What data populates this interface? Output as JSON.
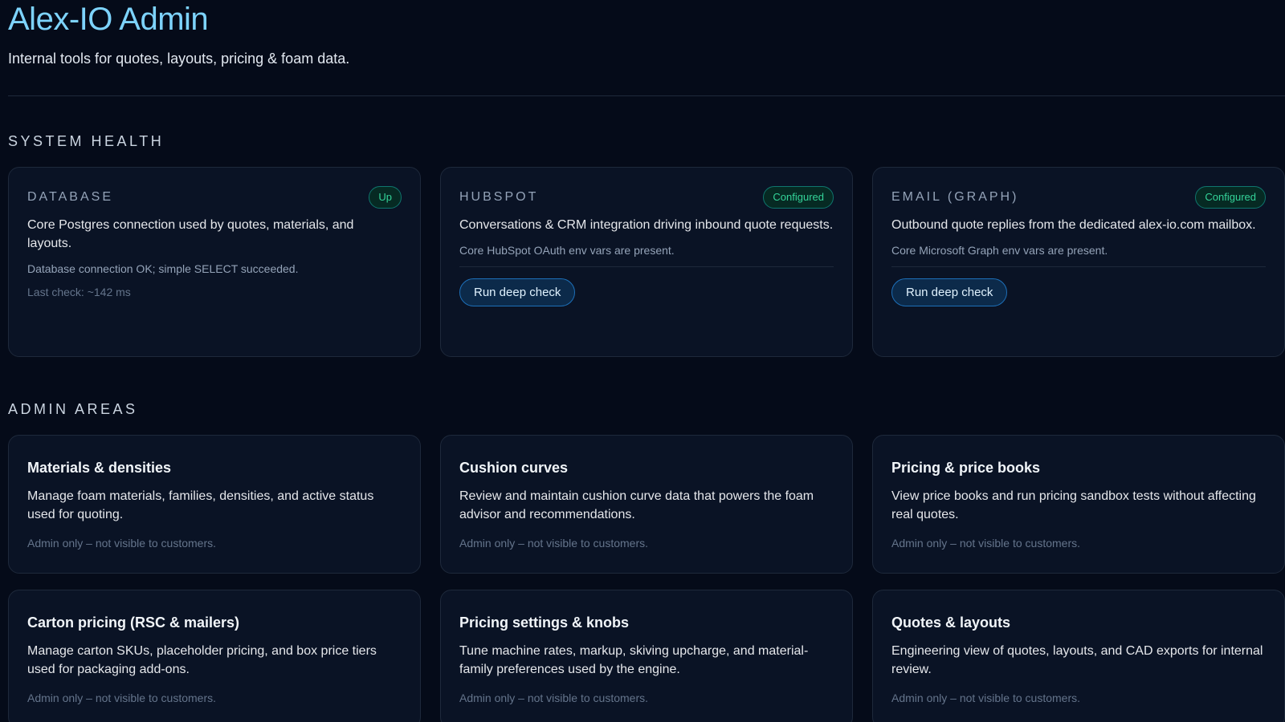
{
  "header": {
    "title": "Alex-IO Admin",
    "subtitle": "Internal tools for quotes, layouts, pricing & foam data."
  },
  "system_health": {
    "section_title": "SYSTEM HEALTH",
    "cards": [
      {
        "label": "DATABASE",
        "status": "Up",
        "description": "Core Postgres connection used by quotes, materials, and layouts.",
        "note": "Database connection OK; simple SELECT succeeded.",
        "latency": "Last check: ~142 ms"
      },
      {
        "label": "HUBSPOT",
        "status": "Configured",
        "description": "Conversations & CRM integration driving inbound quote requests.",
        "note": "Core HubSpot OAuth env vars are present.",
        "button": "Run deep check"
      },
      {
        "label": "EMAIL (GRAPH)",
        "status": "Configured",
        "description": "Outbound quote replies from the dedicated alex-io.com mailbox.",
        "note": "Core Microsoft Graph env vars are present.",
        "button": "Run deep check"
      }
    ]
  },
  "admin_areas": {
    "section_title": "ADMIN AREAS",
    "cards": [
      {
        "title": "Materials & densities",
        "description": "Manage foam materials, families, densities, and active status used for quoting.",
        "note": "Admin only – not visible to customers."
      },
      {
        "title": "Cushion curves",
        "description": "Review and maintain cushion curve data that powers the foam advisor and recommendations.",
        "note": "Admin only – not visible to customers."
      },
      {
        "title": "Pricing & price books",
        "description": "View price books and run pricing sandbox tests without affecting real quotes.",
        "note": "Admin only – not visible to customers."
      },
      {
        "title": "Carton pricing (RSC & mailers)",
        "description": "Manage carton SKUs, placeholder pricing, and box price tiers used for packaging add-ons.",
        "note": "Admin only – not visible to customers."
      },
      {
        "title": "Pricing settings & knobs",
        "description": "Tune machine rates, markup, skiving upcharge, and material-family preferences used by the engine.",
        "note": "Admin only – not visible to customers."
      },
      {
        "title": "Quotes & layouts",
        "description": "Engineering view of quotes, layouts, and CAD exports for internal review.",
        "note": "Admin only – not visible to customers."
      }
    ]
  },
  "colors": {
    "background": "#050b19",
    "accent_title": "#7dd3fc",
    "status_green": "#34d399",
    "button_border": "#1d6fb8"
  }
}
